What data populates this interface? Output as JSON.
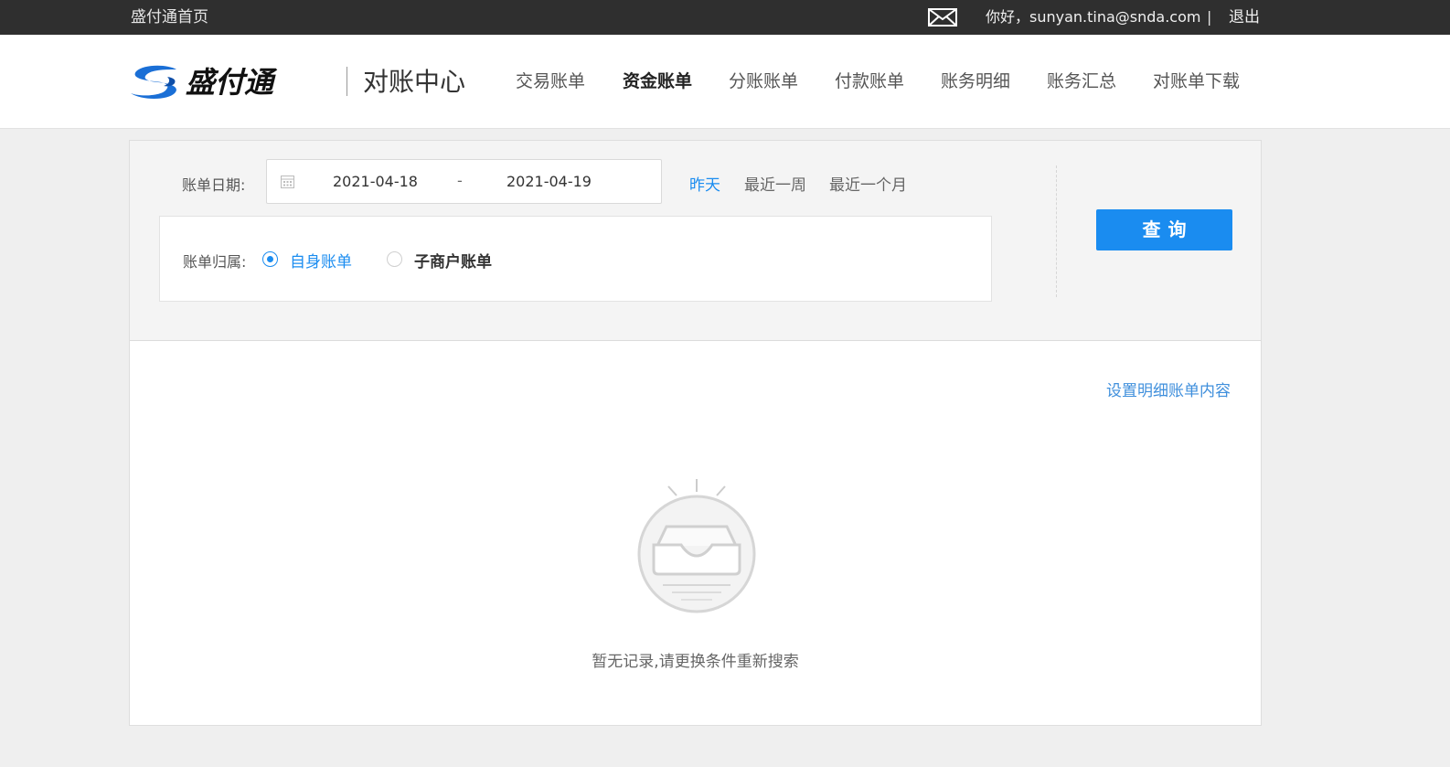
{
  "topbar": {
    "home_link": "盛付通首页",
    "greeting": "你好，sunyan.tina@snda.com",
    "separator": "|",
    "logout": "退出",
    "mail_icon": "mail-icon"
  },
  "header": {
    "logo_alt": "盛付通",
    "subtitle": "对账中心",
    "nav": [
      {
        "label": "交易账单",
        "active": false
      },
      {
        "label": "资金账单",
        "active": true
      },
      {
        "label": "分账账单",
        "active": false
      },
      {
        "label": "付款账单",
        "active": false
      },
      {
        "label": "账务明细",
        "active": false
      },
      {
        "label": "账务汇总",
        "active": false
      },
      {
        "label": "对账单下载",
        "active": false
      }
    ]
  },
  "filter": {
    "date_label": "账单日期:",
    "date_start": "2021-04-18",
    "date_sep": "-",
    "date_end": "2021-04-19",
    "quick_ranges": [
      {
        "label": "昨天",
        "active": true
      },
      {
        "label": "最近一周",
        "active": false
      },
      {
        "label": "最近一个月",
        "active": false
      }
    ],
    "owner_label": "账单归属:",
    "owner_options": [
      {
        "label": "自身账单",
        "selected": true
      },
      {
        "label": "子商户账单",
        "selected": false
      }
    ],
    "query_button": "查询"
  },
  "results": {
    "settings_link": "设置明细账单内容",
    "empty_message": "暂无记录,请更换条件重新搜索"
  },
  "colors": {
    "accent": "#1a8cf0",
    "topbar_bg": "#2f2f2f",
    "page_bg": "#efefef"
  }
}
